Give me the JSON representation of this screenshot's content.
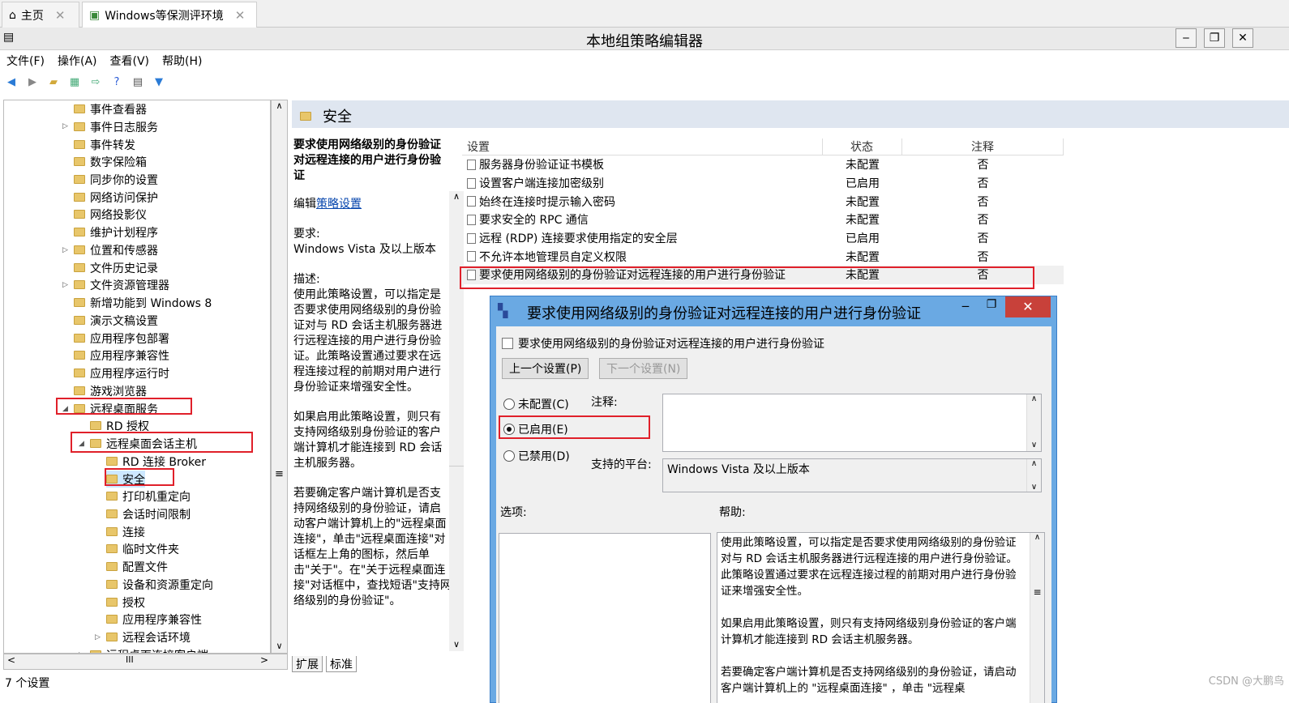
{
  "browser": {
    "tab_home": "主页",
    "tab_active": "Windows等保测评环境"
  },
  "window": {
    "title": "本地组策略编辑器",
    "min": "‒",
    "max": "❐",
    "close": "✕"
  },
  "menu": [
    "文件(F)",
    "操作(A)",
    "查看(V)",
    "帮助(H)"
  ],
  "tree": [
    "事件查看器",
    "事件日志服务",
    "事件转发",
    "数字保险箱",
    "同步你的设置",
    "网络访问保护",
    "网络投影仪",
    "维护计划程序",
    "位置和传感器",
    "文件历史记录",
    "文件资源管理器",
    "新增功能到 Windows 8",
    "演示文稿设置",
    "应用程序包部署",
    "应用程序兼容性",
    "应用程序运行时",
    "游戏浏览器",
    "远程桌面服务",
    "RD 授权",
    "远程桌面会话主机",
    "RD 连接 Broker",
    "安全",
    "打印机重定向",
    "会话时间限制",
    "连接",
    "临时文件夹",
    "配置文件",
    "设备和资源重定向",
    "授权",
    "应用程序兼容性",
    "远程会话环境",
    "远程桌面连接客户端"
  ],
  "scroll": {
    "up": "∧",
    "down": "∨",
    "mid": "≡",
    "left": "<",
    "right": ">",
    "hmid": "III"
  },
  "pane": {
    "title": "安全"
  },
  "desc": {
    "heading": "要求使用网络级别的身份验证对远程连接的用户进行身份验证",
    "edit_prefix": "编辑",
    "edit_link": "策略设置",
    "req_label": "要求:",
    "req_value": "Windows Vista 及以上版本",
    "desc_label": "描述:",
    "p1": "使用此策略设置，可以指定是否要求使用网络级别的身份验证对与 RD 会话主机服务器进行远程连接的用户进行身份验证。此策略设置通过要求在远程连接过程的前期对用户进行身份验证来增强安全性。",
    "p2": "如果启用此策略设置，则只有支持网络级别身份验证的客户端计算机才能连接到 RD 会话主机服务器。",
    "p3": "若要确定客户端计算机是否支持网络级别的身份验证，请启动客户端计算机上的\"远程桌面连接\"，单击\"远程桌面连接\"对话框左上角的图标，然后单击\"关于\"。在\"关于远程桌面连接\"对话框中，查找短语\"支持网络级别的身份验证\"。"
  },
  "list": {
    "headers": [
      "设置",
      "状态",
      "注释"
    ],
    "rows": [
      {
        "name": "服务器身份验证证书模板",
        "state": "未配置",
        "note": "否"
      },
      {
        "name": "设置客户端连接加密级别",
        "state": "已启用",
        "note": "否"
      },
      {
        "name": "始终在连接时提示输入密码",
        "state": "未配置",
        "note": "否"
      },
      {
        "name": "要求安全的 RPC 通信",
        "state": "未配置",
        "note": "否"
      },
      {
        "name": "远程 (RDP) 连接要求使用指定的安全层",
        "state": "已启用",
        "note": "否"
      },
      {
        "name": "不允许本地管理员自定义权限",
        "state": "未配置",
        "note": "否"
      },
      {
        "name": "要求使用网络级别的身份验证对远程连接的用户进行身份验证",
        "state": "未配置",
        "note": "否"
      }
    ]
  },
  "bottom_tabs": [
    "扩展",
    "标准"
  ],
  "status": "7 个设置",
  "dialog": {
    "title": "要求使用网络级别的身份验证对远程连接的用户进行身份验证",
    "subtitle": "要求使用网络级别的身份验证对远程连接的用户进行身份验证",
    "prev": "上一个设置(P)",
    "next": "下一个设置(N)",
    "r1": "未配置(C)",
    "r2": "已启用(E)",
    "r3": "已禁用(D)",
    "note_label": "注释:",
    "platform_label": "支持的平台:",
    "platform_value": "Windows Vista 及以上版本",
    "options_label": "选项:",
    "help_label": "帮助:",
    "help_p1": "使用此策略设置，可以指定是否要求使用网络级别的身份验证对与 RD 会话主机服务器进行远程连接的用户进行身份验证。此策略设置通过要求在远程连接过程的前期对用户进行身份验证来增强安全性。",
    "help_p2": "如果启用此策略设置，则只有支持网络级别身份验证的客户端计算机才能连接到 RD 会话主机服务器。",
    "help_p3": "若要确定客户端计算机是否支持网络级别的身份验证，请启动客户端计算机上的 \"远程桌面连接\" ，单击 \"远程桌"
  },
  "watermark": "CSDN @大鹏鸟",
  "colors": {
    "accent": "#6aa9e3",
    "highlight": "#e0202a"
  }
}
